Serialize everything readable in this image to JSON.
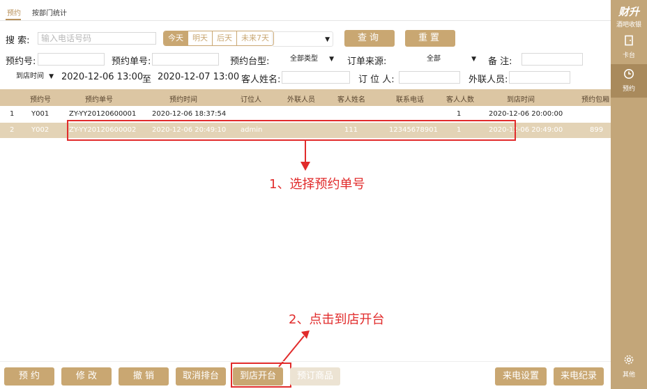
{
  "tabs": [
    {
      "label": "预约",
      "active": true
    },
    {
      "label": "按部门统计",
      "active": false
    }
  ],
  "search": {
    "label": "搜  索:",
    "placeholder": "输入电话号码",
    "segments": [
      "今天",
      "明天",
      "后天",
      "未来7天"
    ],
    "active_segment": 0,
    "query_label": "查询",
    "reset_label": "重置"
  },
  "filters": {
    "reservation_no_label": "预约号:",
    "order_no_label": "预约单号:",
    "table_type_label": "预约台型:",
    "table_type_value": "全部类型",
    "source_label": "订单来源:",
    "source_value": "全部",
    "remark_label": "备  注:",
    "time_type_value": "到店时间",
    "start_time": "2020-12-06 13:00",
    "to_label": "至",
    "end_time": "2020-12-07 13:00",
    "guest_name_label": "客人姓名:",
    "booker_label": "订 位 人:",
    "external_label": "外联人员:"
  },
  "table": {
    "columns": [
      "预约号",
      "预约单号",
      "预约时间",
      "订位人",
      "外联人员",
      "客人姓名",
      "联系电话",
      "客人人数",
      "到店时间",
      "预约包厢"
    ],
    "rows": [
      {
        "idx": "1",
        "no": "Y001",
        "order": "ZY-YY20120600001",
        "time": "2020-12-06 18:37:54",
        "booker": "",
        "external": "",
        "guest": "",
        "phone": "",
        "count": "1",
        "arrive": "2020-12-06 20:00:00",
        "room": ""
      },
      {
        "idx": "2",
        "no": "Y002",
        "order": "ZY-YY20120600002",
        "time": "2020-12-06 20:49:10",
        "booker": "admin",
        "external": "",
        "guest": "111",
        "phone": "12345678901",
        "count": "1",
        "arrive": "2020-12-06 20:49:00",
        "room": "899"
      }
    ],
    "selected_row": 1
  },
  "annotations": {
    "step1": "1、选择预约单号",
    "step2": "2、点击到店开台",
    "color": "#e12b2b"
  },
  "bottom_buttons": {
    "reserve": "预 约",
    "modify": "修 改",
    "cancel": "撤 销",
    "cancel_table": "取消排台",
    "open_table": "到店开台",
    "preorder": "预订商品",
    "call_settings": "来电设置",
    "call_log": "来电纪录"
  },
  "sidebar": {
    "brand_title": "财升",
    "brand_sub": "酒吧收银",
    "items": [
      {
        "label": "卡台",
        "icon": "door-icon"
      },
      {
        "label": "预约",
        "icon": "clock-icon",
        "active": true
      },
      {
        "label": "其他",
        "icon": "gear-icon"
      }
    ]
  },
  "colors": {
    "accent": "#c9a772",
    "header_bg": "#dcc6a3",
    "selected_row_bg": "#e3d3b6",
    "sidebar_bg": "#c3a679"
  }
}
